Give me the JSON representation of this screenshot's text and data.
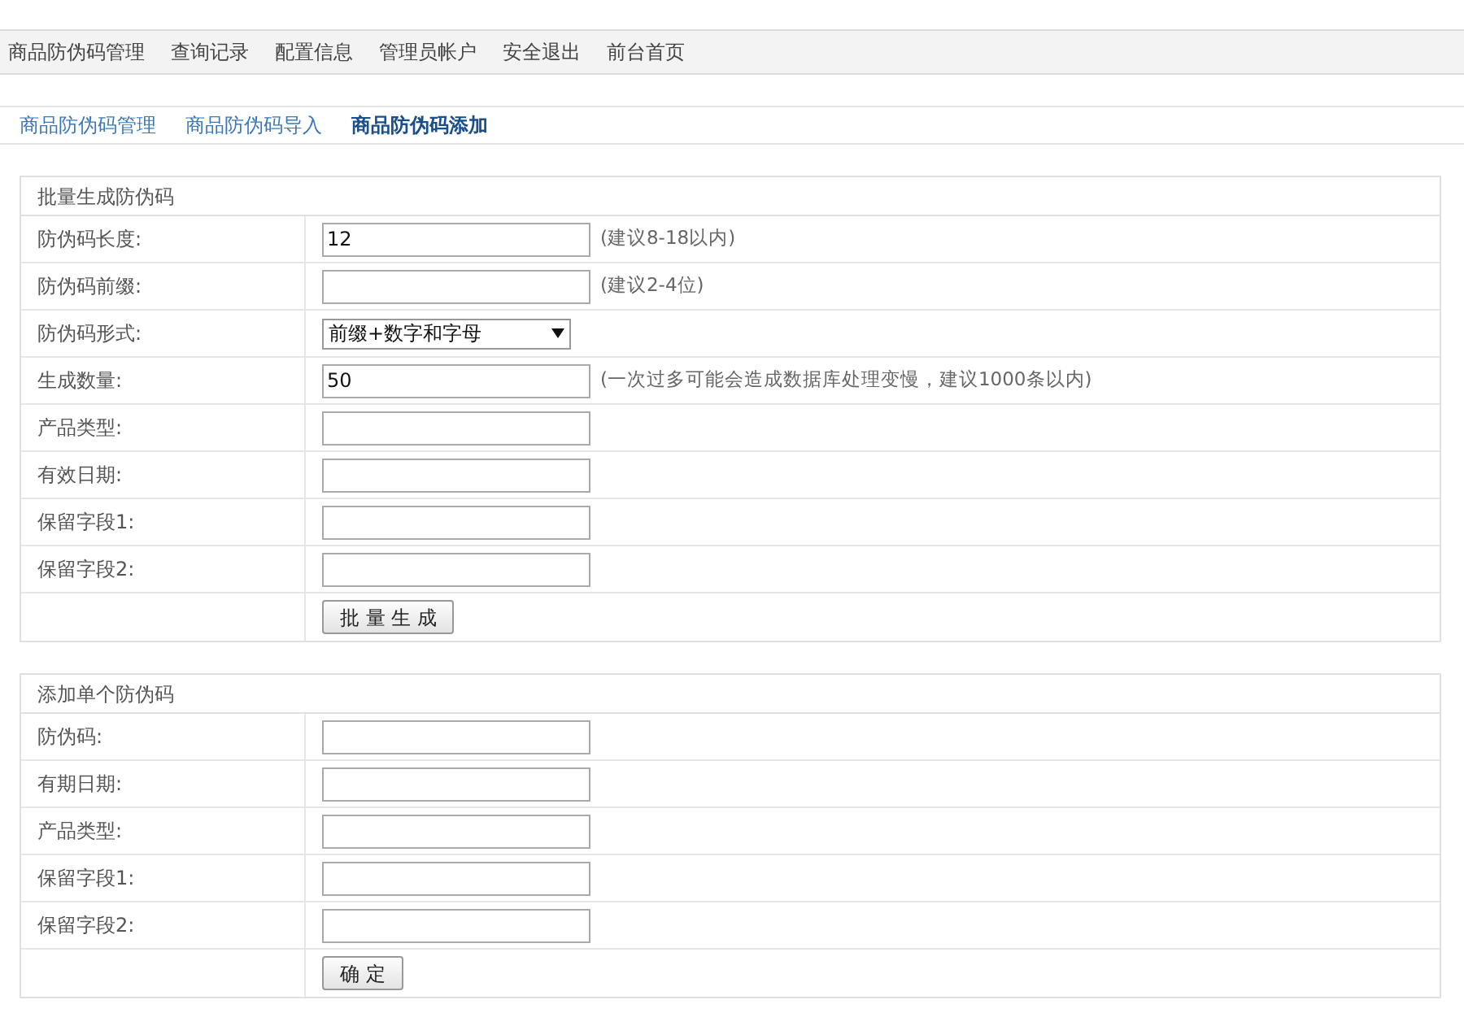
{
  "nav": [
    {
      "label": "商品防伪码管理"
    },
    {
      "label": "查询记录"
    },
    {
      "label": "配置信息"
    },
    {
      "label": "管理员帐户"
    },
    {
      "label": "安全退出"
    },
    {
      "label": "前台首页"
    }
  ],
  "subtabs": [
    {
      "label": "商品防伪码管理",
      "selected": false
    },
    {
      "label": "商品防伪码导入",
      "selected": false
    },
    {
      "label": "商品防伪码添加",
      "selected": true
    }
  ],
  "sections": [
    {
      "title": "批量生成防伪码",
      "button": "批 量 生 成",
      "rows": [
        {
          "kind": "text",
          "label": "防伪码长度:",
          "value": "12",
          "hint": "(建议8-18以内)"
        },
        {
          "kind": "text",
          "label": "防伪码前缀:",
          "hint": "(建议2-4位)"
        },
        {
          "kind": "select",
          "label": "防伪码形式:",
          "value": "前缀+数字和字母"
        },
        {
          "kind": "text",
          "label": "生成数量:",
          "value": "50",
          "hint": "(一次过多可能会造成数据库处理变慢，建议1000条以内)"
        },
        {
          "kind": "text",
          "label": "产品类型:"
        },
        {
          "kind": "text",
          "label": "有效日期:"
        },
        {
          "kind": "text",
          "label": "保留字段1:"
        },
        {
          "kind": "text",
          "label": "保留字段2:"
        }
      ]
    },
    {
      "title": "添加单个防伪码",
      "button": "确 定",
      "rows": [
        {
          "kind": "text",
          "label": "防伪码:"
        },
        {
          "kind": "text",
          "label": "有期日期:"
        },
        {
          "kind": "text",
          "label": "产品类型:"
        },
        {
          "kind": "text",
          "label": "保留字段1:"
        },
        {
          "kind": "text",
          "label": "保留字段2:"
        }
      ]
    }
  ]
}
